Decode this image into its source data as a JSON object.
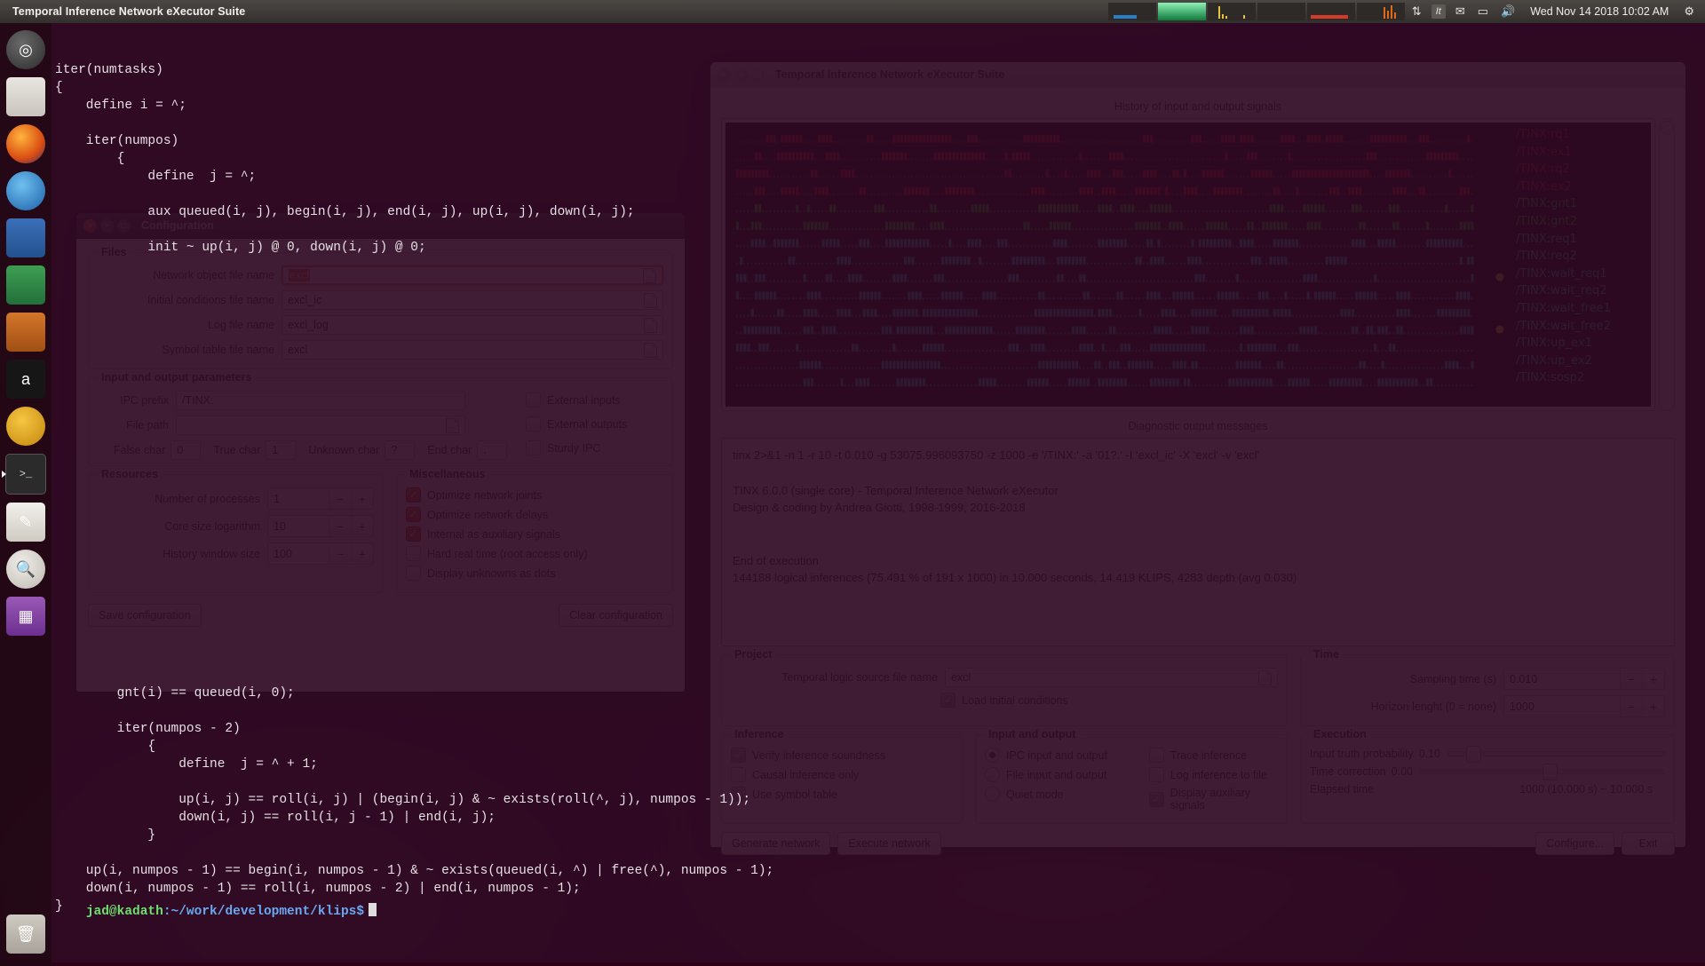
{
  "top_panel": {
    "app_title": "Temporal Inference Network eXecutor Suite",
    "clock": "Wed Nov 14 2018 10:02 AM",
    "icons": [
      "network-icon",
      "keyboard-layout-icon",
      "mail-icon",
      "battery-icon",
      "volume-icon",
      "power-gear-icon"
    ],
    "keyboard_layout": "It"
  },
  "launcher": {
    "items": [
      {
        "name": "dash-home"
      },
      {
        "name": "files"
      },
      {
        "name": "firefox"
      },
      {
        "name": "thunderbird"
      },
      {
        "name": "libreoffice-writer"
      },
      {
        "name": "libreoffice-calc"
      },
      {
        "name": "libreoffice-impress"
      },
      {
        "name": "amazon"
      },
      {
        "name": "ubuntu-software"
      },
      {
        "name": "terminal"
      },
      {
        "name": "text-editor"
      },
      {
        "name": "system-help"
      },
      {
        "name": "workspace-switcher"
      },
      {
        "name": "trash"
      }
    ]
  },
  "terminal": {
    "lines": [
      "iter(numtasks)",
      "{",
      "    define i = ^;",
      "",
      "    iter(numpos)",
      "        {",
      "            define  j = ^;",
      "",
      "            aux queued(i, j), begin(i, j), end(i, j), up(i, j), down(i, j);",
      "",
      "            init ~ up(i, j) @ 0, down(i, j) @ 0;"
    ],
    "lines_lower": [
      "        gnt(i) == queued(i, 0);",
      "",
      "        iter(numpos - 2)",
      "            {",
      "                define  j = ^ + 1;",
      "",
      "                up(i, j) == roll(i, j) | (begin(i, j) & ~ exists(roll(^, j), numpos - 1));",
      "                down(i, j) == roll(i, j - 1) | end(i, j);",
      "            }",
      "",
      "    up(i, numpos - 1) == begin(i, numpos - 1) & ~ exists(queued(i, ^) | free(^), numpos - 1);",
      "    down(i, numpos - 1) == roll(i, numpos - 2) | end(i, numpos - 1);",
      "}"
    ],
    "prompt_user": "jad@kadath",
    "prompt_path": ":~/work/development/klips$"
  },
  "main_window": {
    "title": "Temporal Inference Network eXecutor Suite",
    "history_title": "History of input and output signals",
    "diagnostic_title": "Diagnostic output messages",
    "signals": [
      {
        "name": "/TINX:rq1",
        "color": "#e81c1c"
      },
      {
        "name": "/TINX:ex1",
        "color": "#e81c1c"
      },
      {
        "name": "/TINX:rq2",
        "color": "#e81c1c"
      },
      {
        "name": "/TINX:ex2",
        "color": "#e81c1c"
      },
      {
        "name": "/TINX:gnt1",
        "color": "#18e818"
      },
      {
        "name": "/TINX:gnt2",
        "color": "#18e818"
      },
      {
        "name": "/TINX:req1",
        "color": "#20e0d8"
      },
      {
        "name": "/TINX:req2",
        "color": "#20e0d8"
      },
      {
        "name": "/TINX:wait_req1",
        "color": "#20e0d8"
      },
      {
        "name": "/TINX:wait_req2",
        "color": "#20e0d8"
      },
      {
        "name": "/TINX:wait_free1",
        "color": "#20e0d8"
      },
      {
        "name": "/TINX:wait_free2",
        "color": "#20e0d8"
      },
      {
        "name": "/TINX:up_ex1",
        "color": "#20e0d8"
      },
      {
        "name": "/TINX:up_ex2",
        "color": "#20e0d8"
      },
      {
        "name": "/TINX:sosp2",
        "color": "#20e0d8"
      }
    ],
    "diagnostic_lines": [
      "tinx 2>&1 -n 1 -r 10 -t 0.010 -g 53075.996093750 -z 1000 -e '/TINX:' -a '01?.' -I 'excl_ic' -X 'excl' -v 'excl'",
      "",
      "TINX 6.0.0 (single core) - Temporal Inference Network eXecutor",
      "Design & coding by Andrea Giotti, 1998-1999, 2016-2018",
      "",
      "",
      "End of execution",
      "144188 logical inferences (75.491 % of 191 x 1000) in 10.000 seconds, 14.419 KLIPS, 4283 depth (avg 0.030)"
    ],
    "project": {
      "legend": "Project",
      "source_label": "Temporal logic source file name",
      "source_value": "excl",
      "load_ic_label": "Load initial conditions",
      "load_ic_checked": true
    },
    "time": {
      "legend": "Time",
      "sampling_label": "Sampling time (s)",
      "sampling_value": "0.010",
      "horizon_label": "Horizon lenght (0 = none)",
      "horizon_value": "1000"
    },
    "inference": {
      "legend": "Inference",
      "items": [
        {
          "label": "Verify inference soundness",
          "checked": true
        },
        {
          "label": "Causal inference only",
          "checked": false
        },
        {
          "label": "Use symbol table",
          "checked": true
        }
      ]
    },
    "input_output": {
      "legend": "Input and output",
      "radios": [
        {
          "label": "IPC input and output",
          "selected": true
        },
        {
          "label": "File input and output",
          "selected": false
        },
        {
          "label": "Quiet mode",
          "selected": false
        }
      ],
      "checks": [
        {
          "label": "Trace inference",
          "checked": false
        },
        {
          "label": "Log inference to file",
          "checked": false
        },
        {
          "label": "Display auxiliary signals",
          "checked": true
        }
      ]
    },
    "execution": {
      "legend": "Execution",
      "truth_label": "Input truth probability",
      "truth_value": "0.10",
      "truth_pct": 8,
      "correction_label": "Time correction",
      "correction_value": "0.00",
      "correction_pct": 50,
      "elapsed_label": "Elapsed time",
      "elapsed_value": "1000 (10.000 s) ~ 10.000 s"
    },
    "buttons": {
      "generate": "Generate network",
      "execute": "Execute network",
      "configure": "Configure...",
      "exit": "Exit"
    }
  },
  "config_dialog": {
    "title": "Configuration",
    "files": {
      "legend": "Files",
      "rows": [
        {
          "label": "Network object file name",
          "value": "excl",
          "selected": true
        },
        {
          "label": "Initial conditions file name",
          "value": "excl_ic",
          "selected": false
        },
        {
          "label": "Log file name",
          "value": "excl_log",
          "selected": false
        },
        {
          "label": "Symbol table file name",
          "value": "excl",
          "selected": false
        }
      ]
    },
    "io_params": {
      "legend": "Input and output parameters",
      "ipc_label": "IPC prefix",
      "ipc_value": "/TINX:",
      "path_label": "File path",
      "path_value": "",
      "chars": [
        {
          "label": "False char",
          "value": "0"
        },
        {
          "label": "True char",
          "value": "1"
        },
        {
          "label": "Unknown char",
          "value": "?"
        },
        {
          "label": "End char",
          "value": "."
        }
      ],
      "checks": [
        {
          "label": "External inputs",
          "checked": false
        },
        {
          "label": "External outputs",
          "checked": false
        },
        {
          "label": "Sturdy IPC",
          "checked": false
        }
      ]
    },
    "resources": {
      "legend": "Resources",
      "rows": [
        {
          "label": "Number of processes",
          "value": "1"
        },
        {
          "label": "Core size logarithm",
          "value": "10"
        },
        {
          "label": "History window size",
          "value": "100"
        }
      ]
    },
    "misc": {
      "legend": "Miscellaneous",
      "items": [
        {
          "label": "Optimize network joints",
          "checked": true
        },
        {
          "label": "Optimize network delays",
          "checked": true
        },
        {
          "label": "Internal as auxiliary signals",
          "checked": true
        },
        {
          "label": "Hard real time (root access only)",
          "checked": false
        },
        {
          "label": "Display unknowns as dots",
          "checked": false
        }
      ]
    },
    "buttons": {
      "save": "Save configuration",
      "clear": "Clear configuration"
    }
  }
}
